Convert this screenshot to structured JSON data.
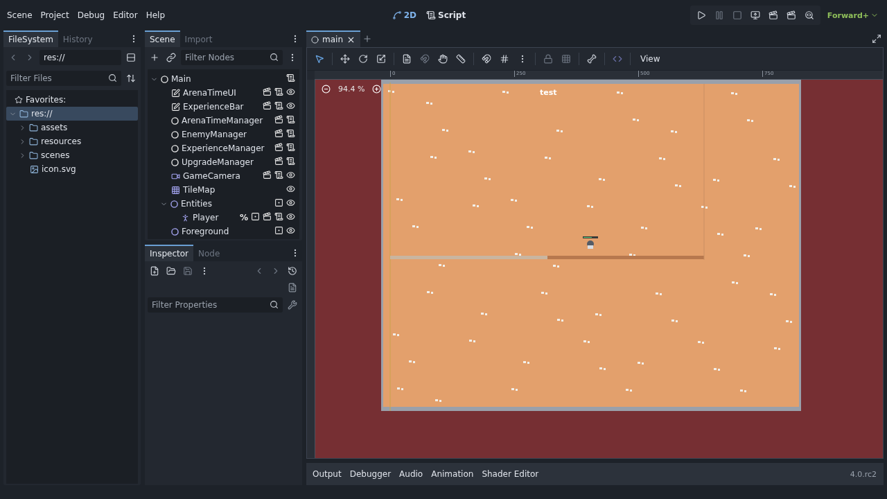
{
  "menu": [
    "Scene",
    "Project",
    "Debug",
    "Editor",
    "Help"
  ],
  "workspaces": [
    {
      "label": "2D",
      "kind": "canvas",
      "selected": true
    },
    {
      "label": "Script",
      "kind": "script",
      "selected": false
    }
  ],
  "renderer": "Forward+",
  "filesystem": {
    "tabs": [
      {
        "label": "FileSystem",
        "selected": true
      },
      {
        "label": "History",
        "selected": false
      }
    ],
    "path": "res://",
    "filter": {
      "placeholder": "Filter Files"
    },
    "favorites": "Favorites:",
    "tree": [
      {
        "name": "res://",
        "kind": "folder",
        "selected": true,
        "expanded": true,
        "children": [
          {
            "name": "assets",
            "kind": "folder",
            "selected": false,
            "expanded": false
          },
          {
            "name": "resources",
            "kind": "folder",
            "selected": false,
            "expanded": false
          },
          {
            "name": "scenes",
            "kind": "folder",
            "selected": false,
            "expanded": false
          },
          {
            "name": "icon.svg",
            "kind": "image",
            "selected": false
          }
        ]
      }
    ]
  },
  "scene_dock": {
    "tabs": [
      {
        "label": "Scene",
        "selected": true
      },
      {
        "label": "Import",
        "selected": false
      }
    ],
    "filter": {
      "placeholder": "Filter Nodes"
    },
    "tree": [
      {
        "name": "Main",
        "kind": "node",
        "badges": [
          {
            "kind": "script"
          }
        ],
        "expanded": true,
        "children": [
          {
            "name": "ArenaTimeUI",
            "kind": "control",
            "badges": [
              {
                "kind": "scene"
              },
              {
                "kind": "script"
              },
              {
                "kind": "visible"
              }
            ]
          },
          {
            "name": "ExperienceBar",
            "kind": "control",
            "badges": [
              {
                "kind": "scene"
              },
              {
                "kind": "script"
              },
              {
                "kind": "visible"
              }
            ]
          },
          {
            "name": "ArenaTimeManager",
            "kind": "node",
            "badges": [
              {
                "kind": "scene"
              },
              {
                "kind": "script"
              }
            ]
          },
          {
            "name": "EnemyManager",
            "kind": "node",
            "badges": [
              {
                "kind": "scene"
              },
              {
                "kind": "script"
              }
            ]
          },
          {
            "name": "ExperienceManager",
            "kind": "node",
            "badges": [
              {
                "kind": "scene"
              },
              {
                "kind": "script"
              }
            ]
          },
          {
            "name": "UpgradeManager",
            "kind": "node",
            "badges": [
              {
                "kind": "scene"
              },
              {
                "kind": "script"
              }
            ]
          },
          {
            "name": "GameCamera",
            "kind": "camera",
            "badges": [
              {
                "kind": "scene"
              },
              {
                "kind": "script"
              },
              {
                "kind": "visible"
              }
            ]
          },
          {
            "name": "TileMap",
            "kind": "tilemap",
            "badges": [
              {
                "kind": "visible"
              }
            ]
          },
          {
            "name": "Entities",
            "kind": "node2d",
            "badges": [
              {
                "kind": "group"
              },
              {
                "kind": "visible"
              }
            ],
            "expanded": true,
            "children": [
              {
                "name": "Player",
                "kind": "character",
                "badges": [
                  {
                    "kind": "unique",
                    "label": "%"
                  },
                  {
                    "kind": "group"
                  },
                  {
                    "kind": "scene"
                  },
                  {
                    "kind": "script"
                  },
                  {
                    "kind": "visible"
                  }
                ]
              }
            ]
          },
          {
            "name": "Foreground",
            "kind": "node2d",
            "badges": [
              {
                "kind": "group"
              },
              {
                "kind": "visible"
              }
            ]
          }
        ]
      }
    ]
  },
  "inspector": {
    "tabs": [
      {
        "label": "Inspector",
        "selected": true
      },
      {
        "label": "Node",
        "selected": false
      }
    ],
    "filter": {
      "placeholder": "Filter Properties"
    }
  },
  "editor": {
    "tabs": [
      {
        "label": "main",
        "selected": true
      }
    ],
    "view_menu": "View",
    "zoom": "94.4 %",
    "ruler": [
      "0",
      "250",
      "500",
      "750"
    ],
    "scene_label": "test"
  },
  "bottom_panel": {
    "tabs": [
      "Output",
      "Debugger",
      "Audio",
      "Animation",
      "Shader Editor"
    ],
    "version": "4.0.rc2"
  }
}
